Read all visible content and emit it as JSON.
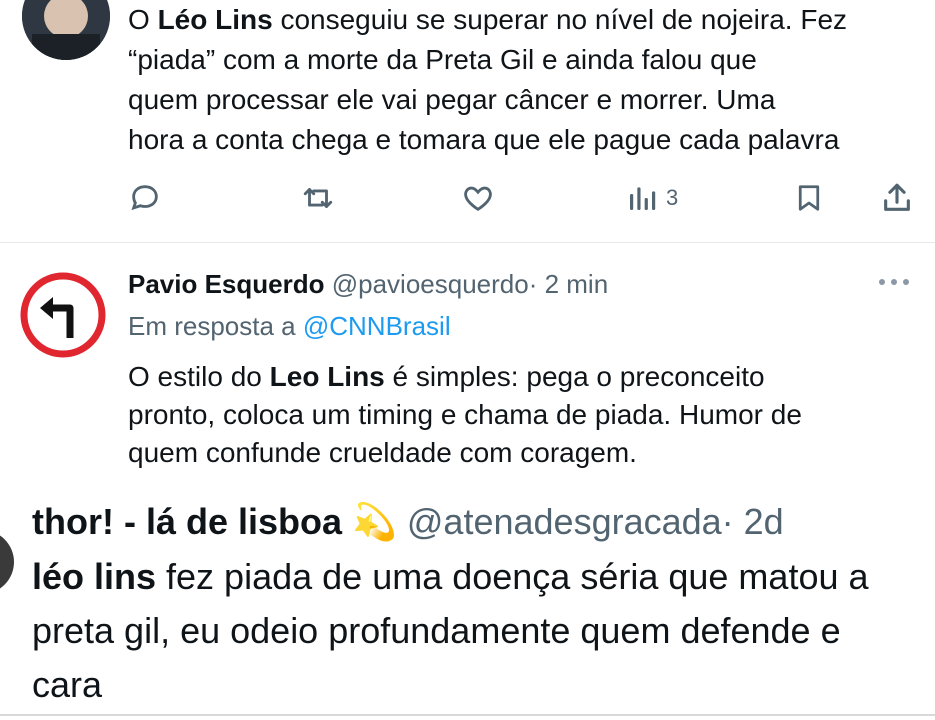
{
  "tweet1": {
    "text_lines": [
      [
        "O ",
        "Léo Lins",
        " conseguiu se superar no nível de nojeira. Fez"
      ],
      "“piada” com a morte da Preta Gil e ainda falou que",
      "quem processar ele vai pegar câncer e morrer. Uma",
      "hora a conta chega e tomara que ele pague cada palavra"
    ],
    "views": "3",
    "icons": [
      "reply-icon",
      "retweet-icon",
      "like-icon",
      "views-icon",
      "bookmark-icon",
      "share-icon"
    ]
  },
  "tweet2": {
    "name": "Pavio Esquerdo",
    "handle": "@pavioesquerdo",
    "time": "· 2 min",
    "reply_prefix": "Em resposta a ",
    "reply_to": "@CNNBrasil",
    "text_lines": [
      [
        "O estilo do ",
        "Leo Lins",
        " é simples: pega o preconceito"
      ],
      "pronto, coloca um timing e chama de piada. Humor de",
      "quem confunde crueldade com coragem."
    ]
  },
  "quoted": {
    "name": "thor! - lá de lisboa",
    "emoji": "💫",
    "handle": "@atenadesgracada",
    "time": "· 2d",
    "text_lines": [
      [
        "léo lins",
        " fez piada de uma doença séria que matou a"
      ],
      "preta gil, eu odeio profundamente quem defende e",
      "cara"
    ]
  },
  "colors": {
    "text": "#0f1419",
    "muted": "#536471",
    "link": "#1d9bf0",
    "sign_red": "#e0262f"
  }
}
